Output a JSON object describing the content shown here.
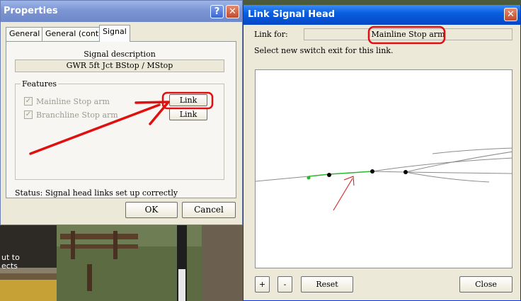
{
  "properties": {
    "title": "Properties",
    "tabs": [
      "General",
      "General (cont.)",
      "Signal"
    ],
    "signal_description_label": "Signal description",
    "signal_description_value": "GWR 5ft Jct BStop / MStop",
    "features_label": "Features",
    "features": [
      {
        "label": "Mainline Stop arm",
        "checked": true,
        "link_label": "Link"
      },
      {
        "label": "Branchline Stop arm",
        "checked": true,
        "link_label": "Link"
      }
    ],
    "status": "Status: Signal head links set up correctly",
    "ok_label": "OK",
    "cancel_label": "Cancel"
  },
  "background": {
    "text_line1": "ut to",
    "text_line2": "ects"
  },
  "link_dialog": {
    "title": "Link Signal Head",
    "link_for_label": "Link for:",
    "link_for_value": "Mainline Stop arm",
    "instruction": "Select new switch exit for this link.",
    "zoom_in_label": "+",
    "zoom_out_label": "-",
    "reset_label": "Reset",
    "close_label": "Close"
  },
  "colors": {
    "annotation": "#e01010",
    "track_selected": "#2db52d",
    "track": "#8c8c8c",
    "node": "#000000"
  }
}
